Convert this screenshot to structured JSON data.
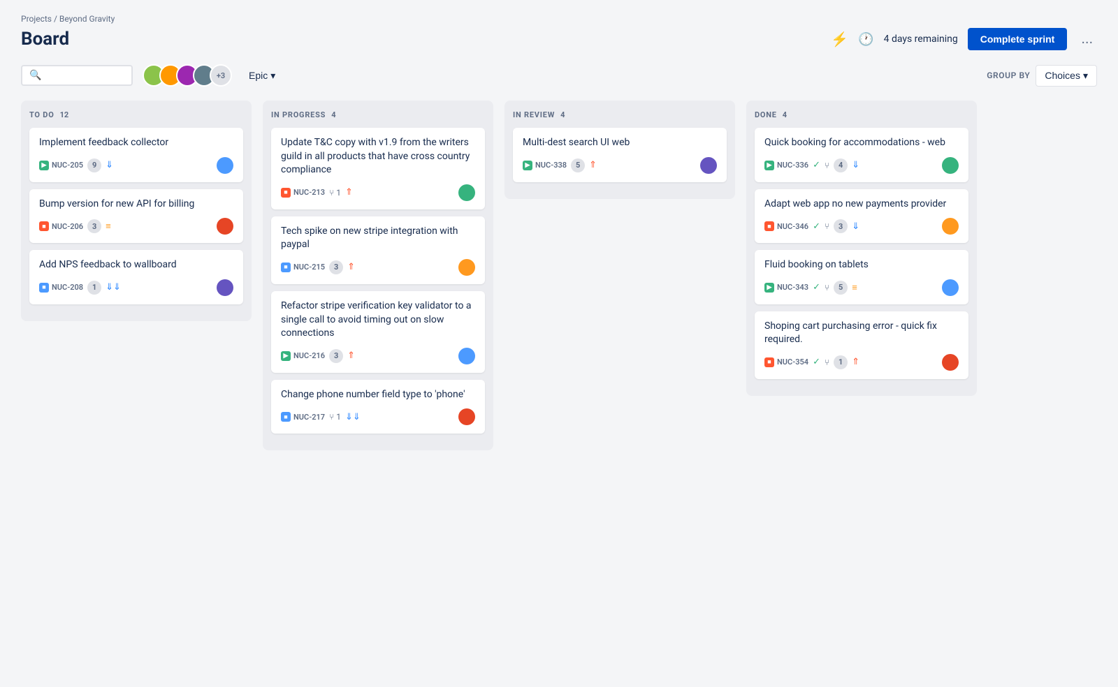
{
  "breadcrumb": "Projects / Beyond Gravity",
  "page_title": "Board",
  "header": {
    "days_remaining": "4 days remaining",
    "complete_sprint": "Complete sprint",
    "more": "..."
  },
  "toolbar": {
    "search_placeholder": "",
    "epic_label": "Epic",
    "group_by_label": "GROUP BY",
    "choices_label": "Choices",
    "avatar_count": "+3"
  },
  "columns": [
    {
      "id": "todo",
      "title": "TO DO",
      "count": 12,
      "cards": [
        {
          "title": "Implement feedback collector",
          "ticket": "NUC-205",
          "icon_type": "story",
          "points": 9,
          "priority": "down",
          "avatar_color": "av1"
        },
        {
          "title": "Bump version for new API for billing",
          "ticket": "NUC-206",
          "icon_type": "bug",
          "points": 3,
          "priority": "medium",
          "avatar_color": "av2"
        },
        {
          "title": "Add NPS feedback to wallboard",
          "ticket": "NUC-208",
          "icon_type": "task",
          "points": 1,
          "priority": "low_down",
          "avatar_color": "av3"
        }
      ]
    },
    {
      "id": "inprogress",
      "title": "IN PROGRESS",
      "count": 4,
      "cards": [
        {
          "title": "Update T&C copy with v1.9 from the writers guild in all products that have cross country compliance",
          "ticket": "NUC-213",
          "icon_type": "bug",
          "points": null,
          "pr": 1,
          "priority": "high",
          "avatar_color": "av4"
        },
        {
          "title": "Tech spike on new stripe integration with paypal",
          "ticket": "NUC-215",
          "icon_type": "task",
          "points": 3,
          "priority": "high",
          "avatar_color": "av5"
        },
        {
          "title": "Refactor stripe verification key validator to a single call to avoid timing out on slow connections",
          "ticket": "NUC-216",
          "icon_type": "story",
          "points": 3,
          "priority": "high",
          "avatar_color": "av1"
        },
        {
          "title": "Change phone number field type to 'phone'",
          "ticket": "NUC-217",
          "icon_type": "task",
          "points": null,
          "pr": 1,
          "priority": "low_down",
          "avatar_color": "av2"
        }
      ]
    },
    {
      "id": "inreview",
      "title": "IN REVIEW",
      "count": 4,
      "cards": [
        {
          "title": "Multi-dest search UI web",
          "ticket": "NUC-338",
          "icon_type": "story",
          "points": 5,
          "priority": "high_up",
          "avatar_color": "av3"
        }
      ]
    },
    {
      "id": "done",
      "title": "DONE",
      "count": 4,
      "cards": [
        {
          "title": "Quick booking for accommodations - web",
          "ticket": "NUC-336",
          "icon_type": "story",
          "points": 4,
          "has_check": true,
          "priority": "down",
          "avatar_color": "av4"
        },
        {
          "title": "Adapt web app no new payments provider",
          "ticket": "NUC-346",
          "icon_type": "bug",
          "points": 3,
          "has_check": true,
          "priority": "down",
          "avatar_color": "av5"
        },
        {
          "title": "Fluid booking on tablets",
          "ticket": "NUC-343",
          "icon_type": "story",
          "points": 5,
          "has_check": true,
          "priority": "medium",
          "avatar_color": "av1"
        },
        {
          "title": "Shoping cart purchasing error - quick fix required.",
          "ticket": "NUC-354",
          "icon_type": "bug",
          "points": 1,
          "has_check": true,
          "priority": "high",
          "avatar_color": "av2"
        }
      ]
    }
  ]
}
